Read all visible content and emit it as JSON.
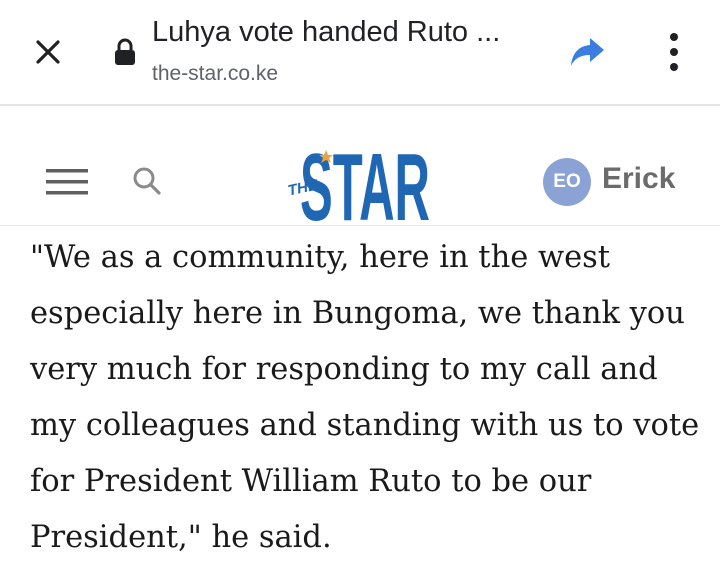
{
  "browser": {
    "title": "Luhya vote handed Ruto ...",
    "url": "the-star.co.ke",
    "icons": {
      "close": "close-icon",
      "lock": "lock-icon",
      "share": "share-icon",
      "more": "more-vert-icon"
    },
    "colors": {
      "share": "#3d7de0"
    }
  },
  "site": {
    "logo": {
      "the": "THE",
      "star": "STAR"
    },
    "colors": {
      "logo": "#1f66b3",
      "star_accent": "#e8a33d",
      "avatar": "#8aa3d4"
    },
    "icons": {
      "menu": "hamburger-menu-icon",
      "search": "search-icon"
    },
    "user": {
      "initials": "EO",
      "name": "Erick"
    }
  },
  "article": {
    "paragraph": "\"We as a community, here in the west especially here in Bungoma, we thank you very much for responding to my call and my colleagues and standing with us to vote for President William Ruto to be our President,\" he said."
  }
}
